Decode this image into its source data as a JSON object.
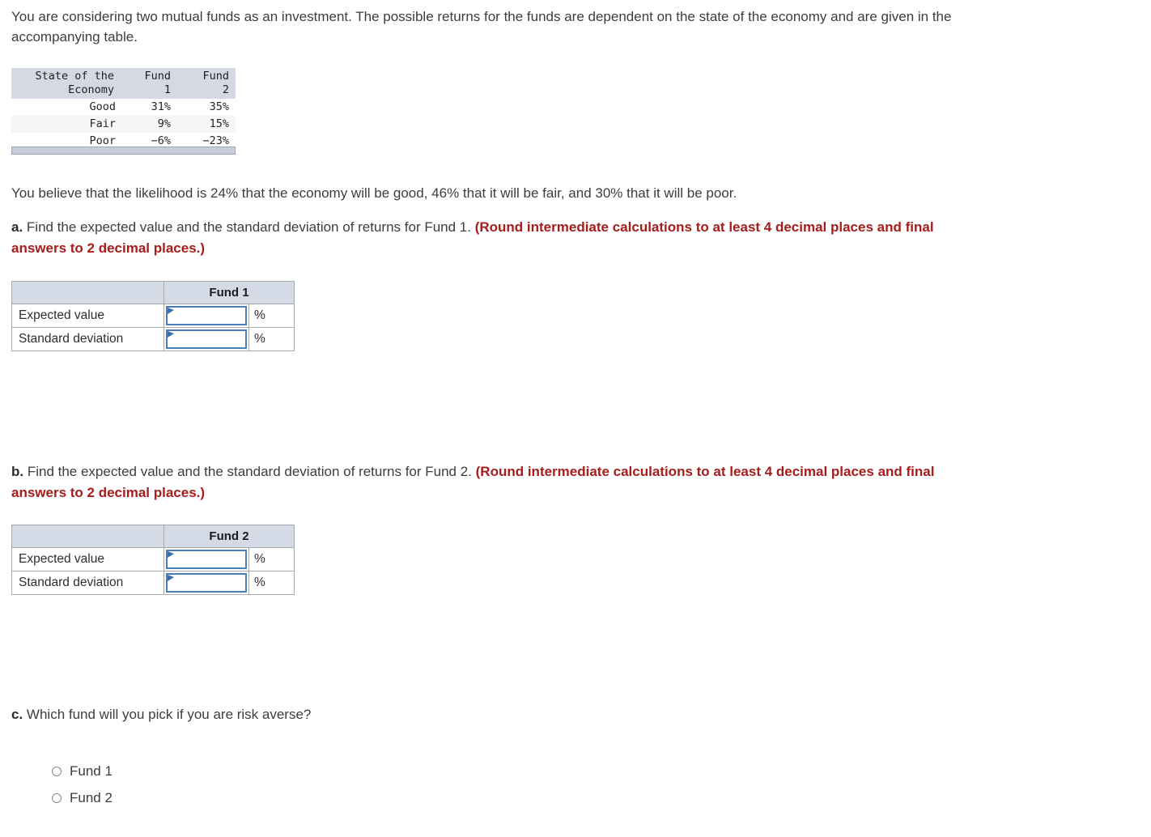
{
  "intro": {
    "paragraph": "You are considering two mutual funds as an investment. The possible returns for the funds are dependent on the state of the economy and are given in the accompanying table."
  },
  "source_table": {
    "headers": {
      "state_line1": "State of the",
      "state_line2": "Economy",
      "fund1_line1": "Fund",
      "fund1_line2": "1",
      "fund2_line1": "Fund",
      "fund2_line2": "2"
    },
    "rows": [
      {
        "state": "Good",
        "fund1": "31%",
        "fund2": "35%"
      },
      {
        "state": "Fair",
        "fund1": "9%",
        "fund2": "15%"
      },
      {
        "state": "Poor",
        "fund1": "−6%",
        "fund2": "−23%"
      }
    ]
  },
  "likelihood": {
    "paragraph": "You believe that the likelihood is 24% that the economy will be good, 46% that it will be fair, and 30% that it will be poor."
  },
  "questions": {
    "a": {
      "letter": "a.",
      "text": " Find the expected value and the standard deviation of returns for Fund 1. ",
      "note": "(Round intermediate calculations to at least 4 decimal places and final answers to 2 decimal places.)"
    },
    "b": {
      "letter": "b.",
      "text": " Find the expected value and the standard deviation of returns for Fund 2. ",
      "note": "(Round intermediate calculations to at least 4 decimal places and final answers to 2 decimal places.)"
    },
    "c": {
      "letter": "c.",
      "text": " Which fund will you pick if you are risk averse?"
    }
  },
  "answer_table_a": {
    "blank_header": "",
    "fund_header": "Fund 1",
    "rows": [
      {
        "label": "Expected value",
        "value": "",
        "unit": "%"
      },
      {
        "label": "Standard deviation",
        "value": "",
        "unit": "%"
      }
    ]
  },
  "answer_table_b": {
    "blank_header": "",
    "fund_header": "Fund 2",
    "rows": [
      {
        "label": "Expected value",
        "value": "",
        "unit": "%"
      },
      {
        "label": "Standard deviation",
        "value": "",
        "unit": "%"
      }
    ]
  },
  "fund_choice": {
    "options": [
      {
        "label": "Fund 1",
        "selected": false
      },
      {
        "label": "Fund 2",
        "selected": false
      }
    ]
  },
  "colors": {
    "note_red": "#a81c1c",
    "body_text": "#3d3d3d",
    "table_header_fill": "#d4dae6",
    "source_header_fill": "#d4d9e4",
    "input_border_blue": "#4a7ebb",
    "scrollbar_fill": "#c8cedb"
  }
}
